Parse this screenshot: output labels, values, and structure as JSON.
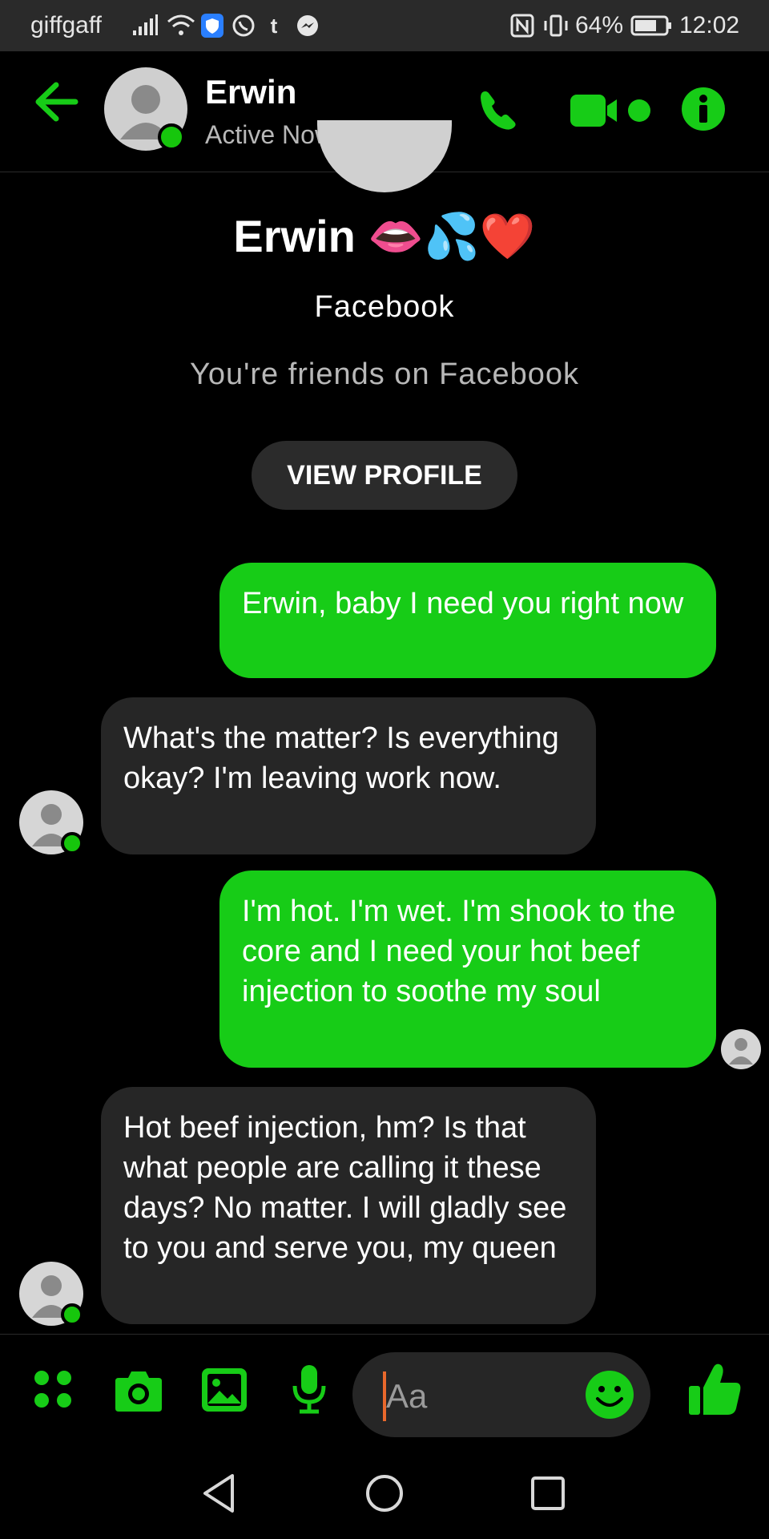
{
  "status_bar": {
    "carrier": "giffgaff",
    "battery": "64%",
    "time": "12:02"
  },
  "header": {
    "contact_name": "Erwin",
    "status": "Active Now"
  },
  "profile": {
    "name": "Erwin",
    "name_emojis": "👄💦❤️",
    "source": "Facebook",
    "friends_text": "You're friends on Facebook",
    "view_profile_label": "VIEW PROFILE"
  },
  "messages": [
    {
      "direction": "outgoing",
      "text": "Erwin, baby I need you right now"
    },
    {
      "direction": "incoming",
      "text": "What's the matter? Is everything okay? I'm leaving work now."
    },
    {
      "direction": "outgoing",
      "text": "I'm hot. I'm wet. I'm shook to the core and I need your hot beef injection to soothe my soul"
    },
    {
      "direction": "incoming",
      "text": "Hot beef injection, hm? Is that what people are calling it these days? No matter. I will gladly see to you and serve you, my queen"
    }
  ],
  "composer": {
    "placeholder": "Aa"
  },
  "colors": {
    "accent": "#17cc17",
    "bubble_incoming": "#262626",
    "background": "#000000"
  }
}
